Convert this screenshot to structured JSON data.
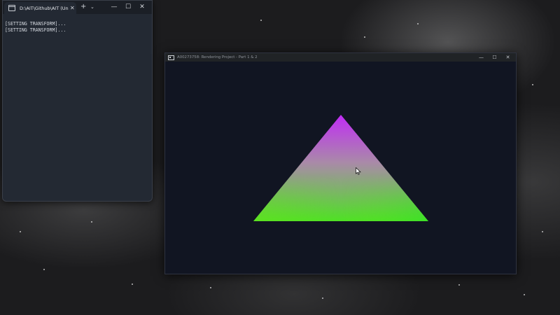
{
  "terminal": {
    "tab_title": "D:\\AIT\\Github\\AIT (Uni Repos",
    "tab_icon": "terminal-icon",
    "new_tab_label": "+",
    "dropdown_label": "⌄",
    "tab_close_label": "✕",
    "minimize_label": "—",
    "maximize_label": "☐",
    "close_label": "✕",
    "lines": [
      "[SETTING TRANSFORM]...",
      "[SETTING TRANSFORM]..."
    ]
  },
  "render_window": {
    "title": "A00273758: Rendering Project - Part 1 & 2",
    "app_icon": "console-app-icon",
    "minimize_label": "—",
    "maximize_label": "☐",
    "close_label": "✕",
    "background_color": "#111522",
    "triangle": {
      "top_color": "#c12cf5",
      "bottom_left_color": "#68e21e",
      "bottom_right_color": "#2ee02a"
    }
  },
  "desktop": {
    "wallpaper": "starfield-nebula"
  }
}
